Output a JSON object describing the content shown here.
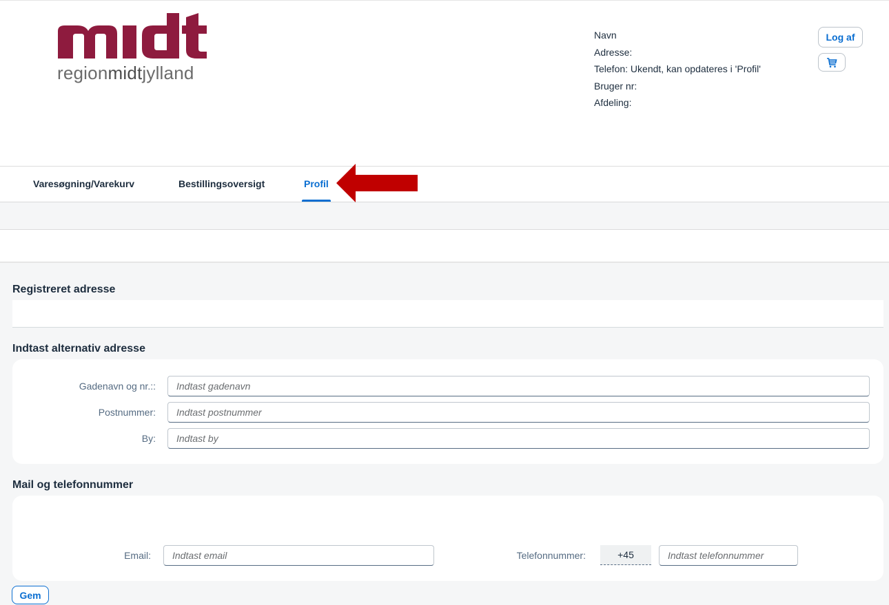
{
  "brand": {
    "logo_main": "midt",
    "logo_sub_prefix": "region",
    "logo_sub_bold": "midt",
    "logo_sub_suffix": "jylland",
    "logo_color": "#8e1b3e"
  },
  "user_info": {
    "name_label": "Navn",
    "address_label": "Adresse:",
    "phone_label": "Telefon: Ukendt, kan opdateres i 'Profil'",
    "user_no_label": "Bruger nr:",
    "department_label": "Afdeling:"
  },
  "header_actions": {
    "logout_label": "Log af",
    "cart_icon": "shopping-cart-icon"
  },
  "tabs": [
    {
      "label": "Varesøgning/Varekurv",
      "active": false
    },
    {
      "label": "Bestillingsoversigt",
      "active": false
    },
    {
      "label": "Profil",
      "active": true
    }
  ],
  "annotation": {
    "arrow_color": "#c00000"
  },
  "sections": {
    "registered": {
      "title": "Registreret adresse"
    },
    "alternative": {
      "title": "Indtast alternativ adresse",
      "fields": [
        {
          "label": "Gadenavn og nr.::",
          "placeholder": "Indtast gadenavn",
          "value": ""
        },
        {
          "label": "Postnummer:",
          "placeholder": "Indtast postnummer",
          "value": ""
        },
        {
          "label": "By:",
          "placeholder": "Indtast by",
          "value": ""
        }
      ]
    },
    "contact": {
      "title": "Mail og telefonnummer",
      "email_label": "Email:",
      "email_placeholder": "Indtast email",
      "phone_label": "Telefonnummer:",
      "phone_prefix": "+45",
      "phone_placeholder": "Indtast telefonnummer"
    }
  },
  "save_label": "Gem",
  "colors": {
    "accent": "#0a6ed1",
    "text": "#1d2d3e",
    "label": "#556b82",
    "background": "#f5f6f7"
  }
}
